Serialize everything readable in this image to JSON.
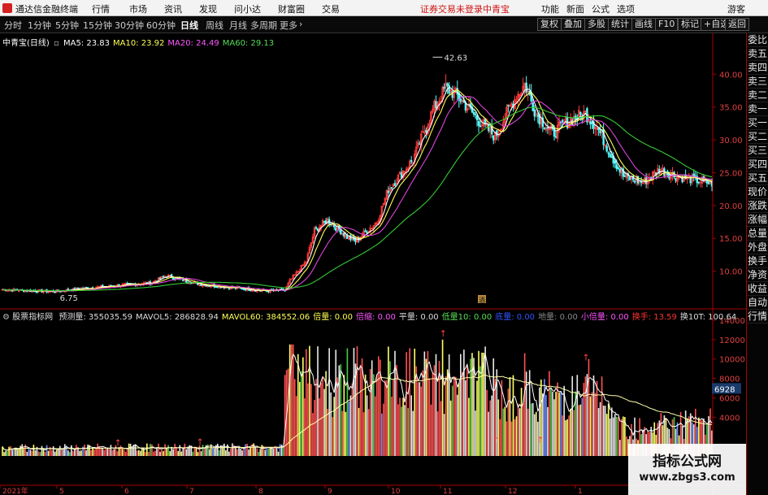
{
  "app": {
    "title": "通达信金融终端"
  },
  "menu": {
    "items": [
      "行情",
      "市场",
      "资讯",
      "发现",
      "问小达",
      "财富圈",
      "交易"
    ],
    "notice": "证券交易未登录",
    "stock": "中青宝",
    "right": [
      "功能",
      "新面",
      "公式",
      "选项"
    ],
    "guest": "游客"
  },
  "toolbar": {
    "periods": [
      "分时",
      "1分钟",
      "5分钟",
      "15分钟",
      "30分钟",
      "60分钟",
      "日线",
      "周线",
      "月线",
      "多周期",
      "更多"
    ],
    "active_period": "日线",
    "right_buttons": [
      "复权",
      "叠加",
      "多股",
      "统计",
      "画线",
      "F10",
      "标记",
      "+自选",
      "返回"
    ]
  },
  "main": {
    "title": "中青宝(日线)",
    "ma": [
      {
        "label": "MA5: 23.83",
        "color": "#ffffff"
      },
      {
        "label": "MA10: 23.92",
        "color": "#ffff55"
      },
      {
        "label": "MA20: 24.49",
        "color": "#ff55ff"
      },
      {
        "label": "MA60: 29.13",
        "color": "#55dd55"
      }
    ],
    "price_ticks": [
      "40.00",
      "35.00",
      "30.00",
      "25.00",
      "20.00",
      "15.00",
      "10.00"
    ],
    "high_label": "42.63",
    "low_label": "6.75",
    "marker": "酒"
  },
  "volume": {
    "title": "股票指标网",
    "items": [
      {
        "label": "预测量: 355035.59",
        "color": "#dddddd"
      },
      {
        "label": "MAVOL5: 286828.94",
        "color": "#dddddd"
      },
      {
        "label": "MAVOL60: 384552.06",
        "color": "#ffff55"
      },
      {
        "label": "倍量: 0.00",
        "color": "#ffff55"
      },
      {
        "label": "倍缩: 0.00",
        "color": "#ff55ff"
      },
      {
        "label": "平量: 0.00",
        "color": "#dddddd"
      },
      {
        "label": "低量10: 0.00",
        "color": "#55dd55"
      },
      {
        "label": "底量: 0.00",
        "color": "#3355ff"
      },
      {
        "label": "地量: 0.00",
        "color": "#888888"
      },
      {
        "label": "小倍量: 0.00",
        "color": "#ff55ff"
      },
      {
        "label": "换手: 13.59",
        "color": "#ff3333"
      },
      {
        "label": "换10T: 100.64",
        "color": "#dddddd"
      }
    ],
    "ticks": [
      "14000",
      "12000",
      "10000",
      "8000",
      "6000",
      "4000"
    ],
    "current": "6928"
  },
  "xaxis": {
    "labels": [
      "2021年",
      "5",
      "6",
      "7",
      "8",
      "9",
      "10",
      "11",
      "12",
      "1"
    ]
  },
  "right_panel": [
    "委比",
    "卖五",
    "卖四",
    "卖三",
    "卖二",
    "卖一",
    "买一",
    "买二",
    "买三",
    "买四",
    "买五",
    "现价",
    "涨跌",
    "涨幅",
    "总量",
    "外盘",
    "换手",
    "净资",
    "收益",
    "自动",
    "行情"
  ],
  "colors": {
    "up": "#ff3b3b",
    "down": "#55ffff",
    "ma5": "#ffffff",
    "ma10": "#ffff55",
    "ma20": "#dd44dd",
    "ma60": "#33cc33",
    "mavol": "#ffffaa",
    "axis": "#aa0000"
  },
  "watermark": {
    "line1": "指标公式网",
    "line2": "www.zbgs3.com"
  }
}
